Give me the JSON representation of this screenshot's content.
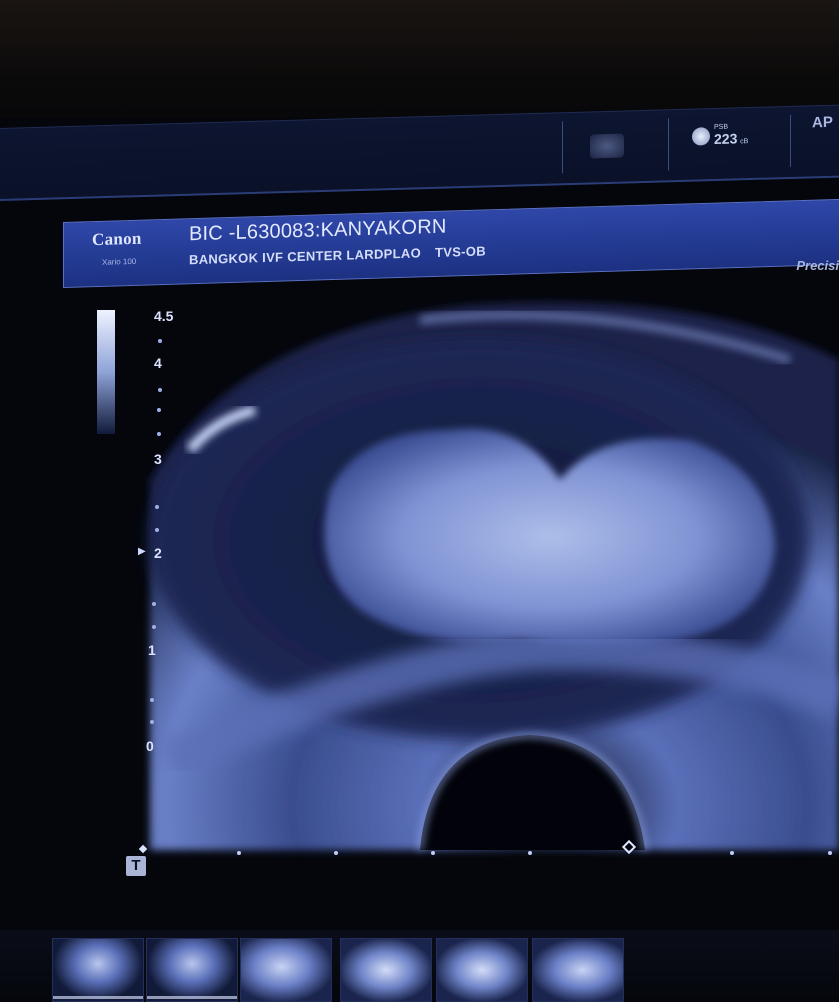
{
  "system_bar": {
    "probe_label": "PSB",
    "probe_value": "223",
    "probe_unit": "cB",
    "mode_label": "AP"
  },
  "header": {
    "brand": "Canon",
    "model": "Xario 100",
    "patient_id": "BIC -L630083:KANYAKORN",
    "institution": "BANGKOK IVF CENTER LARDPLAO",
    "exam": "TVS-OB",
    "preset_label": "Precisi"
  },
  "depth_scale": {
    "unit": "cm",
    "labels": [
      "4.5",
      "4",
      "3",
      "2",
      "1",
      "0"
    ]
  },
  "thumbnails": {
    "count": 6,
    "items": [
      "frame-1",
      "frame-2",
      "frame-3",
      "frame-4",
      "frame-5",
      "frame-6"
    ]
  },
  "colors": {
    "header_bg": "#2a41a0",
    "image_tint": "#6f86d2",
    "background": "#05070d"
  }
}
